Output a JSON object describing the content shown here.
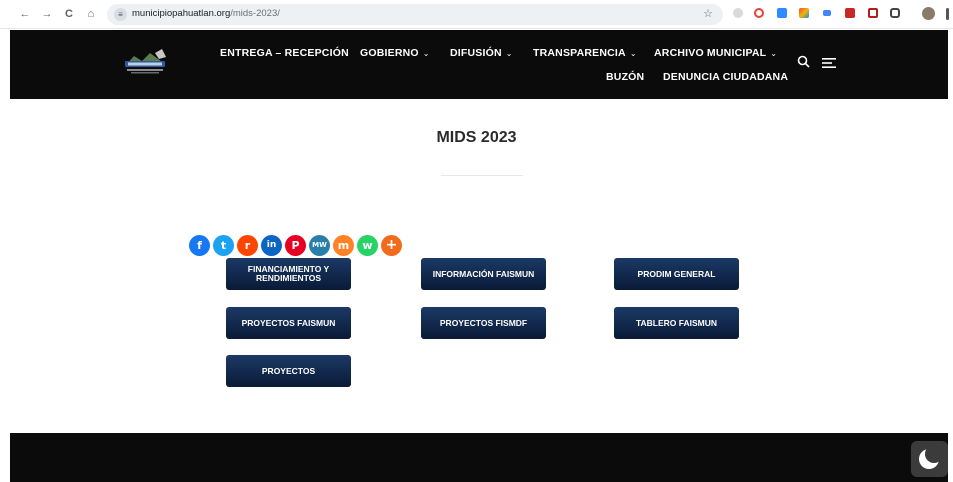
{
  "browser": {
    "url_domain": "municipiopahuatlan.org",
    "url_path": "/mids-2023/",
    "nav_icons": [
      "back-icon",
      "forward-icon",
      "reload-icon",
      "home-icon"
    ],
    "back_glyph": "←",
    "forward_glyph": "→",
    "reload_glyph": "C",
    "home_glyph": "⌂",
    "site_glyph": "≡",
    "star_glyph": "☆"
  },
  "header": {
    "menu": [
      {
        "label": "ENTREGA – RECEPCIÓN",
        "has_dropdown": false
      },
      {
        "label": "GOBIERNO",
        "has_dropdown": true
      },
      {
        "label": "DIFUSIÓN",
        "has_dropdown": true
      },
      {
        "label": "TRANSPARENCIA",
        "has_dropdown": true
      },
      {
        "label": "ARCHIVO MUNICIPAL",
        "has_dropdown": true
      },
      {
        "label": "BUZÓN",
        "has_dropdown": false
      },
      {
        "label": "DENUNCIA CIUDADANA",
        "has_dropdown": false
      }
    ],
    "chevron_glyph": "⌄",
    "search_glyph": "⚲",
    "menu_glyph": "☰",
    "background": "#0b0b0b"
  },
  "page": {
    "title": "MIDS 2023"
  },
  "share": {
    "networks": [
      {
        "name": "facebook",
        "glyph": "f",
        "color": "#1877f2"
      },
      {
        "name": "twitter",
        "glyph": "t",
        "color": "#1da1f2"
      },
      {
        "name": "reddit",
        "glyph": "r",
        "color": "#ff4500"
      },
      {
        "name": "linkedin",
        "glyph": "in",
        "color": "#0a66c2"
      },
      {
        "name": "pinterest",
        "glyph": "P",
        "color": "#e60023"
      },
      {
        "name": "meneame",
        "glyph": "MW",
        "color": "#2a7fa8"
      },
      {
        "name": "mix",
        "glyph": "m",
        "color": "#ff8226"
      },
      {
        "name": "whatsapp",
        "glyph": "w",
        "color": "#25d366"
      },
      {
        "name": "more",
        "glyph": "+",
        "color": "#f26b1d"
      }
    ]
  },
  "buttons": {
    "financiamiento": "FINANCIAMIENTO Y RENDIMIENTOS",
    "informacion_faismun": "INFORMACIÓN FAISMUN",
    "prodim_general": "PRODIM GENERAL",
    "proyectos_faismun": "PROYECTOS FAISMUN",
    "proyectos_fismdf": "PROYECTOS FISMDF",
    "tablero_faismun": "TABLERO FAISMUN",
    "proyectos": "PROYECTOS"
  },
  "toggle": {
    "glyph": "☾"
  },
  "colors": {
    "button_top": "#1b3a66",
    "button_bottom": "#0a1a36",
    "footer": "#0b0b0b"
  }
}
